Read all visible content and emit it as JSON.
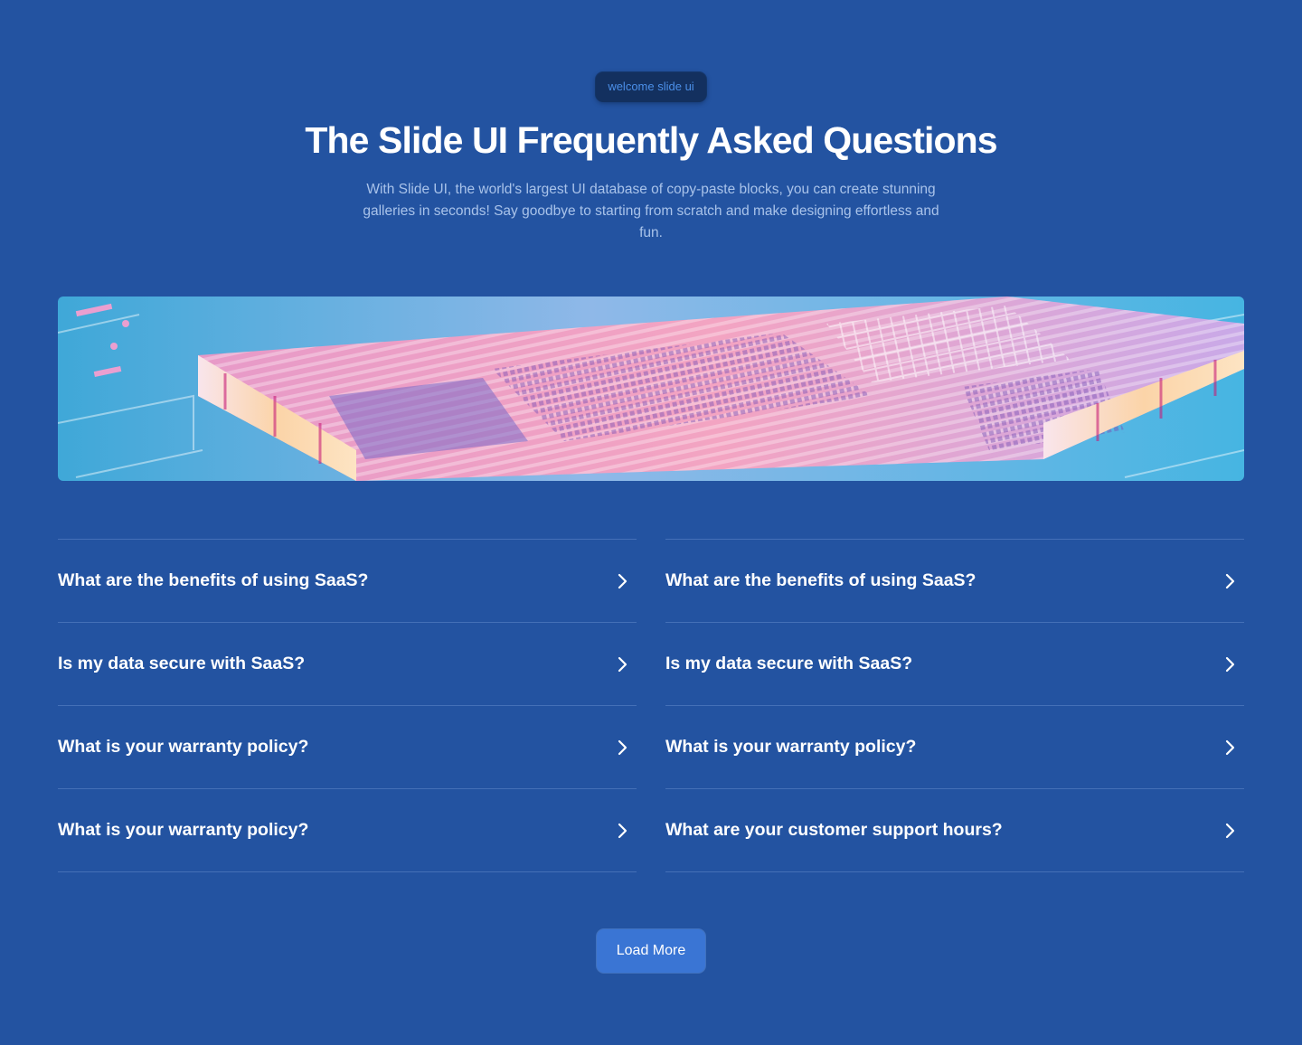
{
  "hero": {
    "badge": "welcome slide ui",
    "title": "The Slide UI Frequently Asked Questions",
    "description": "With Slide UI, the world's largest UI database of copy-paste blocks, you can create stunning galleries in seconds! Say goodbye to starting from scratch and make designing effortless and fun."
  },
  "banner": {
    "icon": "circuit-board-illustration"
  },
  "faq": {
    "left": [
      {
        "question": "What are the benefits of using SaaS?"
      },
      {
        "question": "Is my data secure with SaaS?"
      },
      {
        "question": "What is your warranty policy?"
      },
      {
        "question": "What is your warranty policy?"
      }
    ],
    "right": [
      {
        "question": "What are the benefits of using SaaS?"
      },
      {
        "question": "Is my data secure with SaaS?"
      },
      {
        "question": "What is your warranty policy?"
      },
      {
        "question": "What are your customer support hours?"
      }
    ]
  },
  "actions": {
    "load_more": "Load More"
  },
  "colors": {
    "background": "#2353a1",
    "badge_bg": "#13305f",
    "badge_text": "#4b8fe8",
    "button": "#3a75d4"
  }
}
